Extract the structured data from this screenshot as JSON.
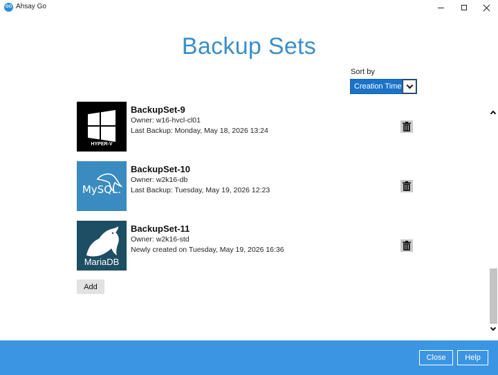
{
  "window": {
    "logo_text": "GO",
    "title": "Ahsay Go"
  },
  "page": {
    "title": "Backup Sets"
  },
  "sort": {
    "label": "Sort by",
    "selected": "Creation Time"
  },
  "backup_sets": [
    {
      "name": "BackupSet-9",
      "owner": "Owner: w16-hvcl-cl01",
      "status": "Last Backup: Monday, May 18, 2026 13:24",
      "icon": "hyper-v-icon",
      "icon_caption": "HYPER-V"
    },
    {
      "name": "BackupSet-10",
      "owner": "Owner: w2k16-db",
      "status": "Last Backup: Tuesday, May 19, 2026 12:23",
      "icon": "mysql-icon",
      "icon_caption": "MySQL."
    },
    {
      "name": "BackupSet-11",
      "owner": "Owner: w2k16-std",
      "status": "Newly created on Tuesday, May 19, 2026 16:36",
      "icon": "mariadb-icon",
      "icon_caption": "MariaDB"
    }
  ],
  "actions": {
    "add_label": "Add"
  },
  "footer": {
    "close_label": "Close",
    "help_label": "Help"
  },
  "colors": {
    "title_blue": "#3a8fca",
    "footer_blue": "#3b95e3",
    "select_blue": "#1a73c8"
  }
}
